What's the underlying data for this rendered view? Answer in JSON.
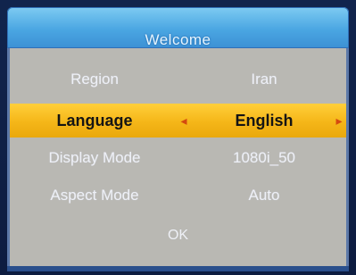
{
  "dialog": {
    "title": "Welcome",
    "settings": [
      {
        "label": "Region",
        "value": "Iran",
        "selected": false
      },
      {
        "label": "Language",
        "value": "English",
        "selected": true
      },
      {
        "label": "Display Mode",
        "value": "1080i_50",
        "selected": false
      },
      {
        "label": "Aspect Mode",
        "value": "Auto",
        "selected": false
      }
    ],
    "ok_label": "OK",
    "arrows": {
      "left": "◂",
      "right": "▸"
    }
  },
  "colors": {
    "header": "#4aa6e2",
    "panel": "#b9b8b3",
    "highlight": "#f5b618",
    "arrow": "#d44a0f"
  }
}
